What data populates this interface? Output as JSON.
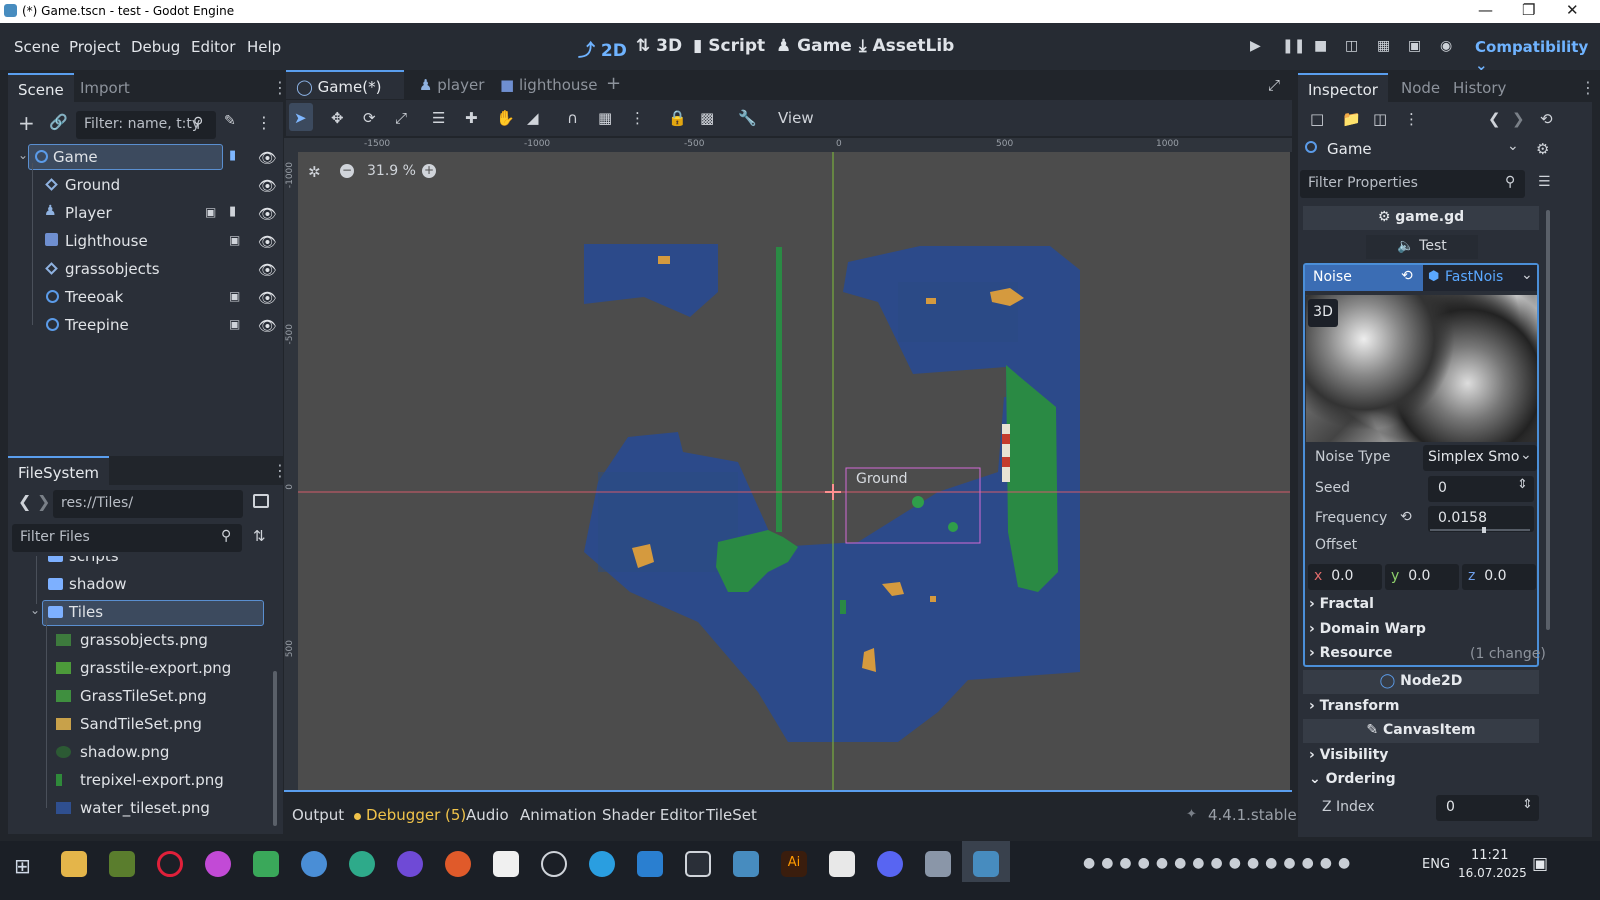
{
  "window": {
    "title": "(*) Game.tscn - test - Godot Engine"
  },
  "menu": {
    "items": [
      "Scene",
      "Project",
      "Debug",
      "Editor",
      "Help"
    ]
  },
  "workspaces": {
    "w2d": "2D",
    "w3d": "3D",
    "script": "Script",
    "game": "Game",
    "assetlib": "AssetLib"
  },
  "renderer": "Compatibility",
  "scene_dock": {
    "tab_scene": "Scene",
    "tab_import": "Import",
    "filter_placeholder": "Filter: name, t:ty",
    "nodes": [
      {
        "label": "Game"
      },
      {
        "label": "Ground"
      },
      {
        "label": "Player"
      },
      {
        "label": "Lighthouse"
      },
      {
        "label": "grassobjects"
      },
      {
        "label": "Treeoak"
      },
      {
        "label": "Treepine"
      }
    ]
  },
  "filesystem": {
    "tab": "FileSystem",
    "path": "res://Tiles/",
    "filter_placeholder": "Filter Files",
    "items": [
      {
        "label": "scripts"
      },
      {
        "label": "shadow"
      },
      {
        "label": "Tiles"
      },
      {
        "label": "grassobjects.png"
      },
      {
        "label": "grasstile-export.png"
      },
      {
        "label": "GrassTileSet.png"
      },
      {
        "label": "SandTileSet.png"
      },
      {
        "label": "shadow.png"
      },
      {
        "label": "trepixel-export.png"
      },
      {
        "label": "water_tileset.png"
      }
    ]
  },
  "editor_tabs": {
    "game": "Game(*)",
    "player": "player",
    "lighthouse": "lighthouse"
  },
  "toolbar": {
    "view": "View"
  },
  "viewport": {
    "zoom": "31.9 %",
    "ground_label": "Ground",
    "ruler_h": [
      "-1500",
      "-1000",
      "-500",
      "0",
      "500",
      "1000"
    ],
    "ruler_v": [
      "-1000",
      "-500",
      "0",
      "500"
    ]
  },
  "bottom_panel": {
    "tabs": [
      "Output",
      "Debugger (5)",
      "Audio",
      "Animation",
      "Shader Editor",
      "TileSet"
    ],
    "version": "4.4.1.stable"
  },
  "inspector": {
    "tab_inspector": "Inspector",
    "tab_node": "Node",
    "tab_history": "History",
    "object": "Game",
    "filter_placeholder": "Filter Properties",
    "script_header": "game.gd",
    "export_group": "Test",
    "noise_label": "Noise",
    "noise_value": "FastNois",
    "preview_badge": "3D",
    "noise_type_label": "Noise Type",
    "noise_type_value": "Simplex Smo",
    "seed_label": "Seed",
    "seed_value": "0",
    "frequency_label": "Frequency",
    "frequency_value": "0.0158",
    "offset_label": "Offset",
    "offset_x": "0.0",
    "offset_y": "0.0",
    "offset_z": "0.0",
    "x": "x",
    "y": "y",
    "z": "z",
    "fractal": "Fractal",
    "domain_warp": "Domain Warp",
    "resource": "Resource",
    "resource_change": "(1 change)",
    "node2d": "Node2D",
    "transform": "Transform",
    "canvasitem": "CanvasItem",
    "visibility": "Visibility",
    "ordering": "Ordering",
    "zindex_label": "Z Index",
    "zindex_value": "0"
  },
  "taskbar": {
    "lang": "ENG",
    "time": "11:21",
    "date": "16.07.2025"
  }
}
